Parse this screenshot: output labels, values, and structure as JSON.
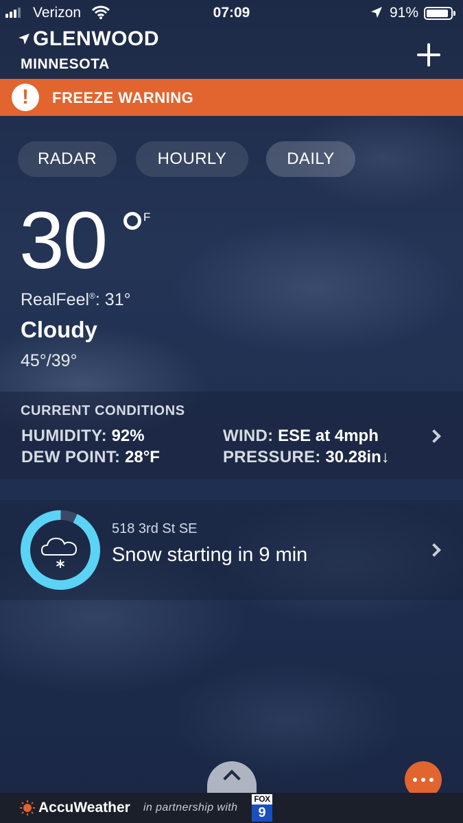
{
  "status_bar": {
    "carrier": "Verizon",
    "time": "07:09",
    "battery_percent": "91%",
    "battery_level": 0.91
  },
  "location": {
    "city": "GLENWOOD",
    "state": "MINNESOTA"
  },
  "alert": {
    "icon": "!",
    "text": "FREEZE WARNING",
    "color": "#e2642e"
  },
  "tabs": [
    {
      "label": "RADAR"
    },
    {
      "label": "HOURLY"
    },
    {
      "label": "DAILY"
    }
  ],
  "current": {
    "temperature": "30",
    "unit": "F",
    "realfeel_label": "RealFeel",
    "realfeel_mark": "®",
    "realfeel_value": ": 31°",
    "phrase": "Cloudy",
    "hi_lo": "45°/39°"
  },
  "conditions": {
    "title": "CURRENT CONDITIONS",
    "humidity_label": "HUMIDITY:",
    "humidity_value": "92%",
    "dew_point_label": "DEW POINT:",
    "dew_point_value": "28°F",
    "wind_label": "WIND:",
    "wind_value": "ESE at 4mph",
    "pressure_label": "PRESSURE:",
    "pressure_value": "30.28in",
    "pressure_trend": "↓"
  },
  "minutecast": {
    "address": "518 3rd St SE",
    "text": "Snow starting in 9 min",
    "precip_fraction": 0.93,
    "ring_color": "#5bd3f5",
    "icon": "cloud-snow-icon"
  },
  "footer": {
    "brand": "AccuWeather",
    "partner_text": "in partnership with",
    "partner_logo_top": "FOX",
    "partner_logo_bottom": "9"
  },
  "colors": {
    "accent": "#e2642e",
    "background": "#1f2f50"
  }
}
